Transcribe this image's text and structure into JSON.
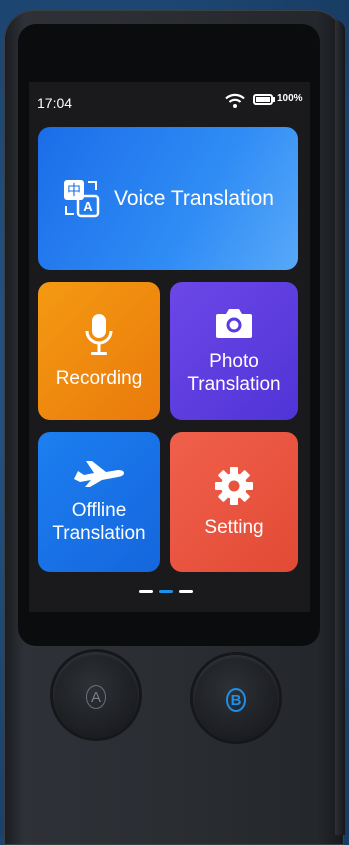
{
  "status_bar": {
    "time": "17:04",
    "battery": "100%"
  },
  "tiles": {
    "voice": "Voice Translation",
    "recording": "Recording",
    "photo_line1": "Photo",
    "photo_line2": "Translation",
    "offline_line1": "Offline",
    "offline_line2": "Translation",
    "setting": "Setting"
  },
  "translate_icon_glyph": "中",
  "translate_icon_letter": "A",
  "page_indicator": {
    "count": 3,
    "active": 2
  },
  "hardware_buttons": {
    "a": "A",
    "b": "B"
  },
  "colors": {
    "voice": "#2f8cf5",
    "recording": "#ea7a0c",
    "photo": "#5a3be0",
    "offline": "#1870e6",
    "setting": "#e8533d",
    "button_b_accent": "#1e90e8"
  },
  "icons": [
    "wifi-icon",
    "battery-icon",
    "translate-icon",
    "microphone-icon",
    "camera-icon",
    "airplane-icon",
    "gear-icon"
  ]
}
